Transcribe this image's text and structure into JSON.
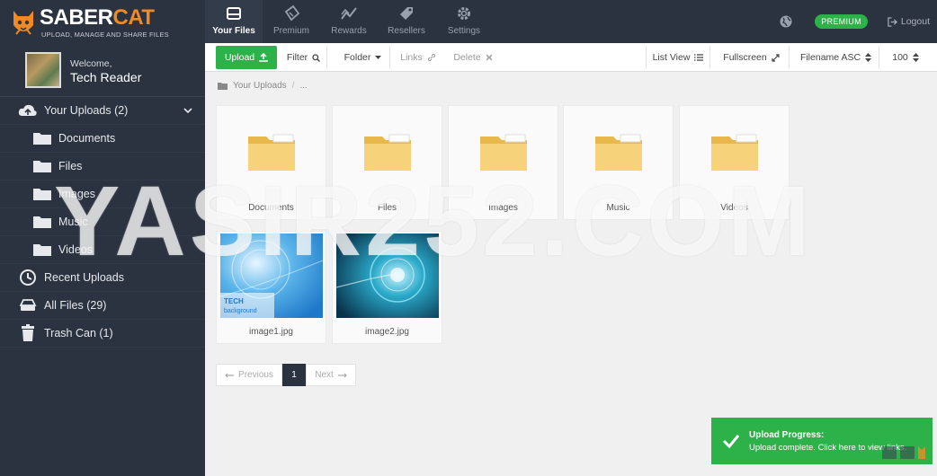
{
  "brand": {
    "title_white": "SABER",
    "title_orange": "CAT",
    "subtitle": "UPLOAD, MANAGE AND SHARE FILES"
  },
  "nav": [
    {
      "label": "Your Files",
      "icon": "drive-icon",
      "active": true
    },
    {
      "label": "Premium",
      "icon": "ticket-icon"
    },
    {
      "label": "Rewards",
      "icon": "chart-icon"
    },
    {
      "label": "Resellers",
      "icon": "tag-icon"
    },
    {
      "label": "Settings",
      "icon": "gear-icon"
    }
  ],
  "topright": {
    "premium": "PREMIUM",
    "logout": "Logout"
  },
  "user": {
    "welcome": "Welcome,",
    "name": "Tech Reader"
  },
  "sidebar": [
    {
      "label": "Your Uploads (2)",
      "icon": "cloud-upload-icon"
    },
    {
      "label": "Documents",
      "icon": "folder-icon"
    },
    {
      "label": "Files",
      "icon": "folder-icon"
    },
    {
      "label": "Images",
      "icon": "folder-icon"
    },
    {
      "label": "Music",
      "icon": "folder-icon"
    },
    {
      "label": "Videos",
      "icon": "folder-icon"
    },
    {
      "label": "Recent Uploads",
      "icon": "clock-icon"
    },
    {
      "label": "All Files (29)",
      "icon": "drive-icon"
    },
    {
      "label": "Trash Can (1)",
      "icon": "trash-icon"
    }
  ],
  "toolbar": {
    "upload": "Upload",
    "filter": "Filter",
    "folder": "Folder",
    "links": "Links",
    "delete": "Delete",
    "list_view": "List View",
    "fullscreen": "Fullscreen",
    "sort": "Filename ASC",
    "per_page": "100"
  },
  "breadcrumb": {
    "root": "Your Uploads",
    "sep": "/",
    "more": "..."
  },
  "folders": [
    "Documents",
    "Files",
    "Images",
    "Music",
    "Videos"
  ],
  "images": [
    {
      "name": "image1.jpg",
      "overlay_line1": "TECH",
      "overlay_line2": "background"
    },
    {
      "name": "image2.jpg"
    }
  ],
  "pager": {
    "prev": "Previous",
    "current": "1",
    "next": "Next"
  },
  "watermark": "YASIR252.COM",
  "toast": {
    "title": "Upload Progress:",
    "message": "Upload complete. Click here to view links."
  },
  "colors": {
    "dark": "#2b3340",
    "accent": "#2db24a",
    "brand_orange": "#f08a24"
  }
}
